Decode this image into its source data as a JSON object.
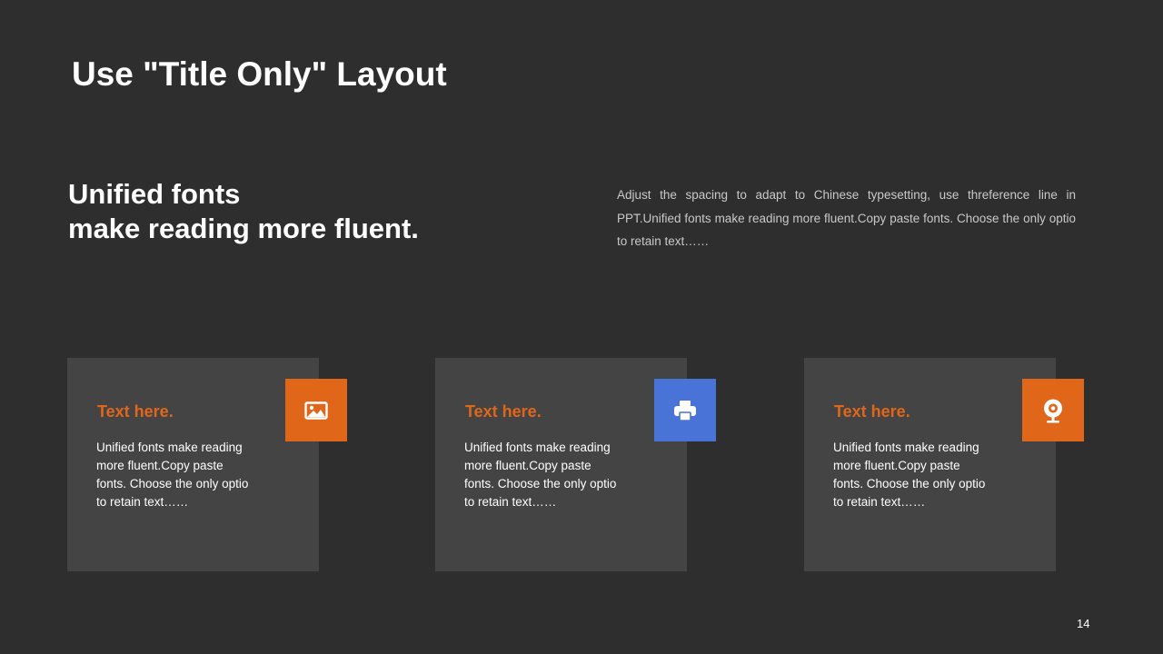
{
  "slide": {
    "title": "Use \"Title Only\" Layout",
    "page_number": "14"
  },
  "headline": {
    "line1": "Unified fonts",
    "line2": "make reading more fluent."
  },
  "description": "Adjust the spacing to adapt to Chinese typesetting, use threference line in PPT.Unified fonts make reading more fluent.Copy paste fonts. Choose the only optio to retain text……",
  "cards": [
    {
      "title": "Text here.",
      "body": "Unified fonts make reading more fluent.Copy paste fonts. Choose the only optio to retain text……",
      "icon": "image-icon",
      "icon_color": "#e0661a"
    },
    {
      "title": "Text here.",
      "body": "Unified fonts make reading more fluent.Copy paste fonts. Choose the only optio to retain text……",
      "icon": "printer-icon",
      "icon_color": "#4a73d8"
    },
    {
      "title": "Text here.",
      "body": "Unified fonts make reading more fluent.Copy paste fonts. Choose the only optio to retain text……",
      "icon": "webcam-icon",
      "icon_color": "#e0661a"
    }
  ],
  "colors": {
    "background": "#2e2e2e",
    "card": "#444444",
    "accent_orange": "#e0661a",
    "accent_blue": "#4a73d8"
  }
}
